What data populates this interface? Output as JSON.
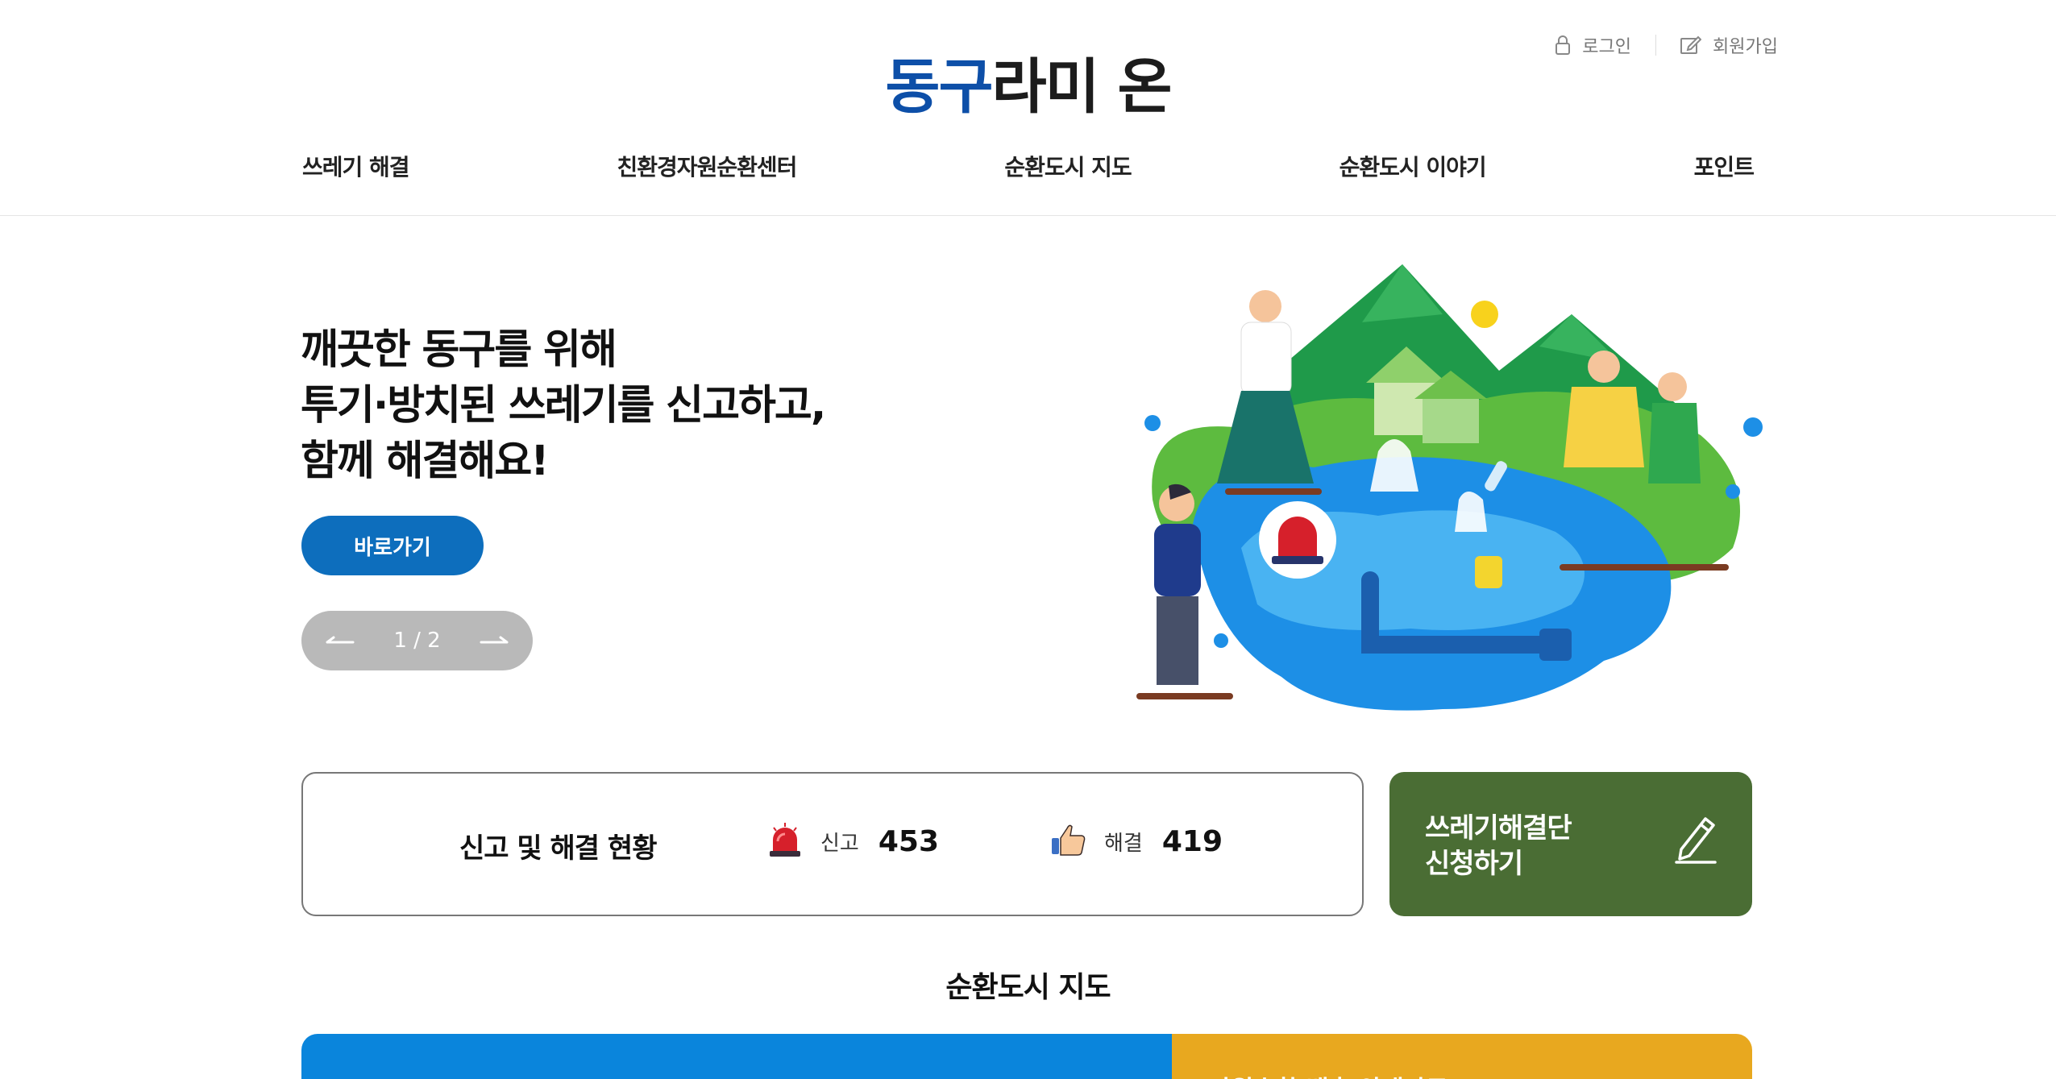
{
  "header": {
    "logo_part1": "동구",
    "logo_part2": "라미 온",
    "login": "로그인",
    "signup": "회원가입"
  },
  "nav": [
    {
      "label": "쓰레기 해결"
    },
    {
      "label": "친환경자원순환센터"
    },
    {
      "label": "순환도시 지도"
    },
    {
      "label": "순환도시 이야기"
    },
    {
      "label": "포인트"
    }
  ],
  "hero": {
    "line1": "깨끗한 동구를 위해",
    "line2": "투기·방치된 쓰레기를 신고하고,",
    "line3": "함께 해결해요!",
    "button": "바로가기",
    "pager": "1 / 2"
  },
  "status": {
    "title": "신고 및 해결 현황",
    "report_label": "신고",
    "report_value": "453",
    "resolve_label": "해결",
    "resolve_value": "419"
  },
  "apply": {
    "line1": "쓰레기해결단",
    "line2": "신청하기"
  },
  "map_section": {
    "title": "순환도시 지도",
    "card_right_text": "자원순환 배출 안내자료"
  },
  "colors": {
    "brand_blue": "#0d4fa8",
    "button_blue": "#0d6ebd",
    "apply_green": "#4a6d34",
    "map_blue": "#0a85dc",
    "map_yellow": "#e8a81f"
  }
}
